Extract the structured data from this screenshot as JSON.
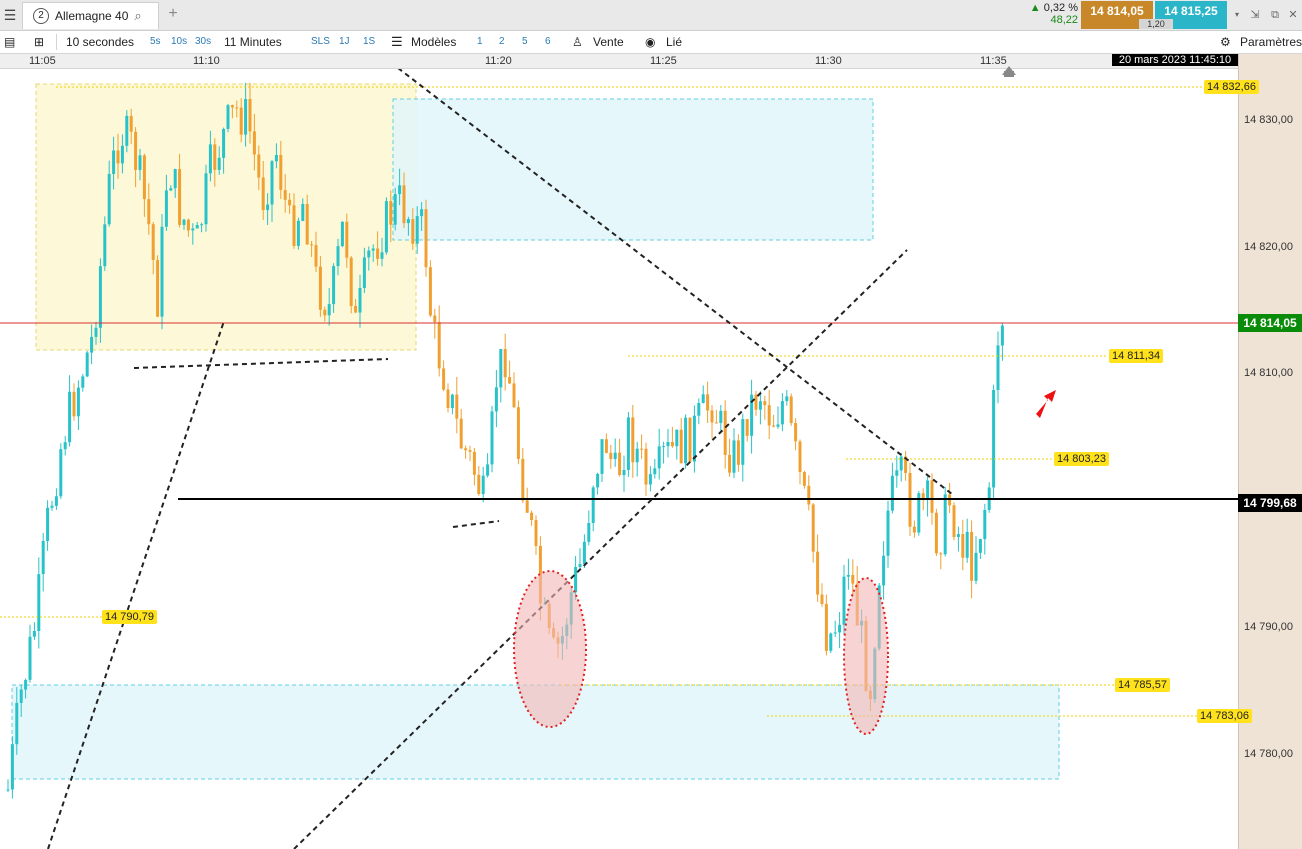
{
  "tabbar": {
    "menu_icon": "menu-icon",
    "tab_number": "2",
    "tab_title": "Allemagne 40",
    "search_icon": "search-icon",
    "add_tab_icon": "plus-icon",
    "change_arrow": "▲",
    "change_percent": "0,32 %",
    "change_points": "48,22",
    "bid": "14 814,05",
    "ask": "14 815,25",
    "spread": "1,20",
    "colors": {
      "bid": "#c8882a",
      "ask": "#2bb5c8"
    }
  },
  "toolbar": {
    "interval": "10 secondes",
    "intervals_short": [
      "5s",
      "10s",
      "30s"
    ],
    "duration": "11 Minutes",
    "periods": [
      "SLS",
      "1J",
      "1S"
    ],
    "models": "Modèles",
    "model_numbers": [
      "1",
      "2",
      "5",
      "6"
    ],
    "sell": "Vente",
    "linked": "Lié",
    "settings": "Paramètres"
  },
  "time_axis": {
    "labels": [
      "11:05",
      "11:10",
      "11:20",
      "11:25",
      "11:30",
      "11:35"
    ],
    "date": "20 mars 2023 11:45:10"
  },
  "price_axis": {
    "labels": [
      "14 830,00",
      "14 820,00",
      "14 810,00",
      "14 790,00",
      "14 780,00"
    ],
    "current_price": "14 814,05",
    "black_line_price": "14 799,68",
    "colors": {
      "current": "#0a8c0a",
      "black_line": "#000000"
    }
  },
  "annotations": {
    "levels": [
      "14 832,66",
      "14 811,34",
      "14 803,23",
      "14 790,79",
      "14 785,57",
      "14 783,06"
    ]
  }
}
